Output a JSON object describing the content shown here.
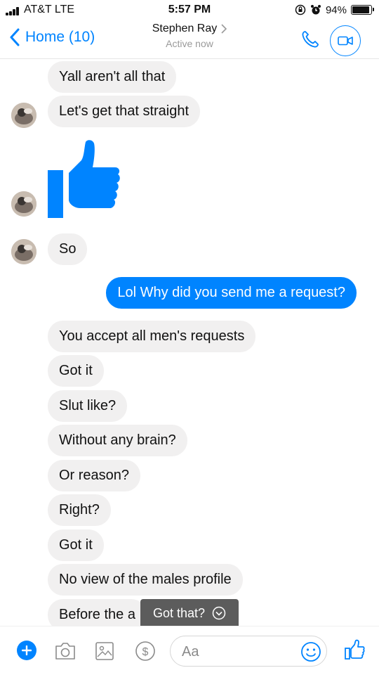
{
  "status_bar": {
    "carrier": "AT&T  LTE",
    "time": "5:57 PM",
    "battery": "94%",
    "battery_level": 0.94
  },
  "header": {
    "back_label": "Home (10)",
    "contact_name": "Stephen Ray",
    "active_status": "Active now",
    "accent_color": "#0084ff"
  },
  "messages": [
    {
      "side": "in",
      "text": "Yall aren't all that"
    },
    {
      "side": "in",
      "text": "Let's get that straight"
    },
    {
      "side": "in",
      "sticker": "thumbs-up"
    },
    {
      "side": "in",
      "text": "So"
    },
    {
      "side": "out",
      "text": "Lol Why did you send me a request?"
    },
    {
      "side": "in",
      "text": "You accept all men's requests"
    },
    {
      "side": "in",
      "text": "Got it"
    },
    {
      "side": "in",
      "text": "Slut like?"
    },
    {
      "side": "in",
      "text": "Without any brain?"
    },
    {
      "side": "in",
      "text": "Or reason?"
    },
    {
      "side": "in",
      "text": "Right?"
    },
    {
      "side": "in",
      "text": "Got it"
    },
    {
      "side": "in",
      "text": "No view of the males profile"
    },
    {
      "side": "in",
      "text": "Before the a"
    }
  ],
  "toast": {
    "label": "Got that?"
  },
  "composer": {
    "placeholder": "Aa",
    "icons": [
      "plus-icon",
      "camera-icon",
      "gallery-icon",
      "payment-icon",
      "emoji-icon",
      "thumbs-up-icon"
    ]
  }
}
